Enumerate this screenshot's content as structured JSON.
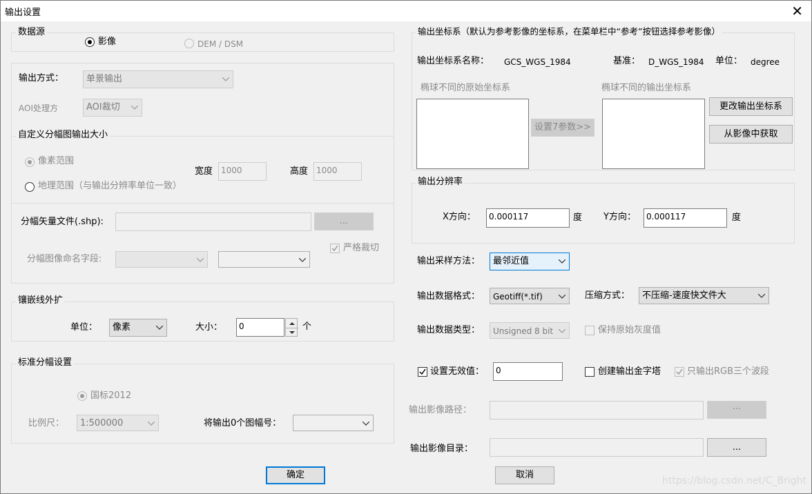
{
  "window": {
    "title": "输出设置",
    "close_glyph": "✕"
  },
  "data_source": {
    "group_title": "数据源",
    "option_image": "影像",
    "option_dem": "DEM / DSM"
  },
  "output_mode": {
    "label": "输出方式：",
    "value": "单景输出",
    "aoi_label": "AOI处理方",
    "aoi_value": "AOI裁切"
  },
  "custom_tile": {
    "group_title": "自定义分幅图输出大小",
    "option_pixel": "像素范围",
    "option_geo": "地理范围（与输出分辨率单位一致）",
    "width_label": "宽度",
    "width_value": "1000",
    "height_label": "高度",
    "height_value": "1000"
  },
  "vector": {
    "label": "分幅矢量文件(.shp):",
    "value": "",
    "browse": "...",
    "strict_clip": "严格裁切",
    "naming_label": "分幅图像命名字段:",
    "naming_value": "",
    "naming_value2": ""
  },
  "mosaic": {
    "group_title": "镶嵌线外扩",
    "unit_label": "单位：",
    "unit_value": "像素",
    "size_label": "大小：",
    "size_value": "0",
    "size_unit": "个"
  },
  "standard": {
    "group_title": "标准分幅设置",
    "option_national": "国标2012",
    "scale_label": "比例尺：",
    "scale_value": "1:500000",
    "output_label": "将输出0个图幅号：",
    "output_value": ""
  },
  "coord": {
    "group_title": "输出坐标系（默认为参考影像的坐标系，在菜单栏中“参考”按钮选择参考影像）",
    "name_label": "输出坐标系名称：",
    "name_value": "GCS_WGS_1984",
    "datum_label": "基准：",
    "datum_value": "D_WGS_1984",
    "unit_label": "单位：",
    "unit_value": "degree",
    "src_list_label": "椭球不同的原始坐标系",
    "dst_list_label": "椭球不同的输出坐标系",
    "set7_button": "设置7参数>>",
    "change_button": "更改输出坐标系",
    "from_image_button": "从影像中获取"
  },
  "resolution": {
    "group_title": "输出分辨率",
    "x_label": "X方向：",
    "x_value": "0.000117",
    "x_unit": "度",
    "y_label": "Y方向：",
    "y_value": "0.000117",
    "y_unit": "度"
  },
  "output": {
    "resample_label": "输出采样方法：",
    "resample_value": "最邻近值",
    "format_label": "输出数据格式：",
    "format_value": "Geotiff(*.tif)",
    "compress_label": "压缩方式：",
    "compress_value": "不压缩-速度快文件大",
    "dtype_label": "输出数据类型：",
    "dtype_value": "Unsigned 8 bit",
    "keep_gray": "保持原始灰度值",
    "nodata_label": "设置无效值：",
    "nodata_value": "0",
    "pyramid": "创建输出金字塔",
    "rgb_only": "只输出RGB三个波段",
    "path_label": "输出影像路径：",
    "path_value": "",
    "path_browse": "···",
    "dir_label": "输出影像目录：",
    "dir_value": "",
    "dir_browse": "..."
  },
  "footer": {
    "ok": "确定",
    "cancel": "取消",
    "watermark": "https://blog.csdn.net/C_Bright"
  }
}
